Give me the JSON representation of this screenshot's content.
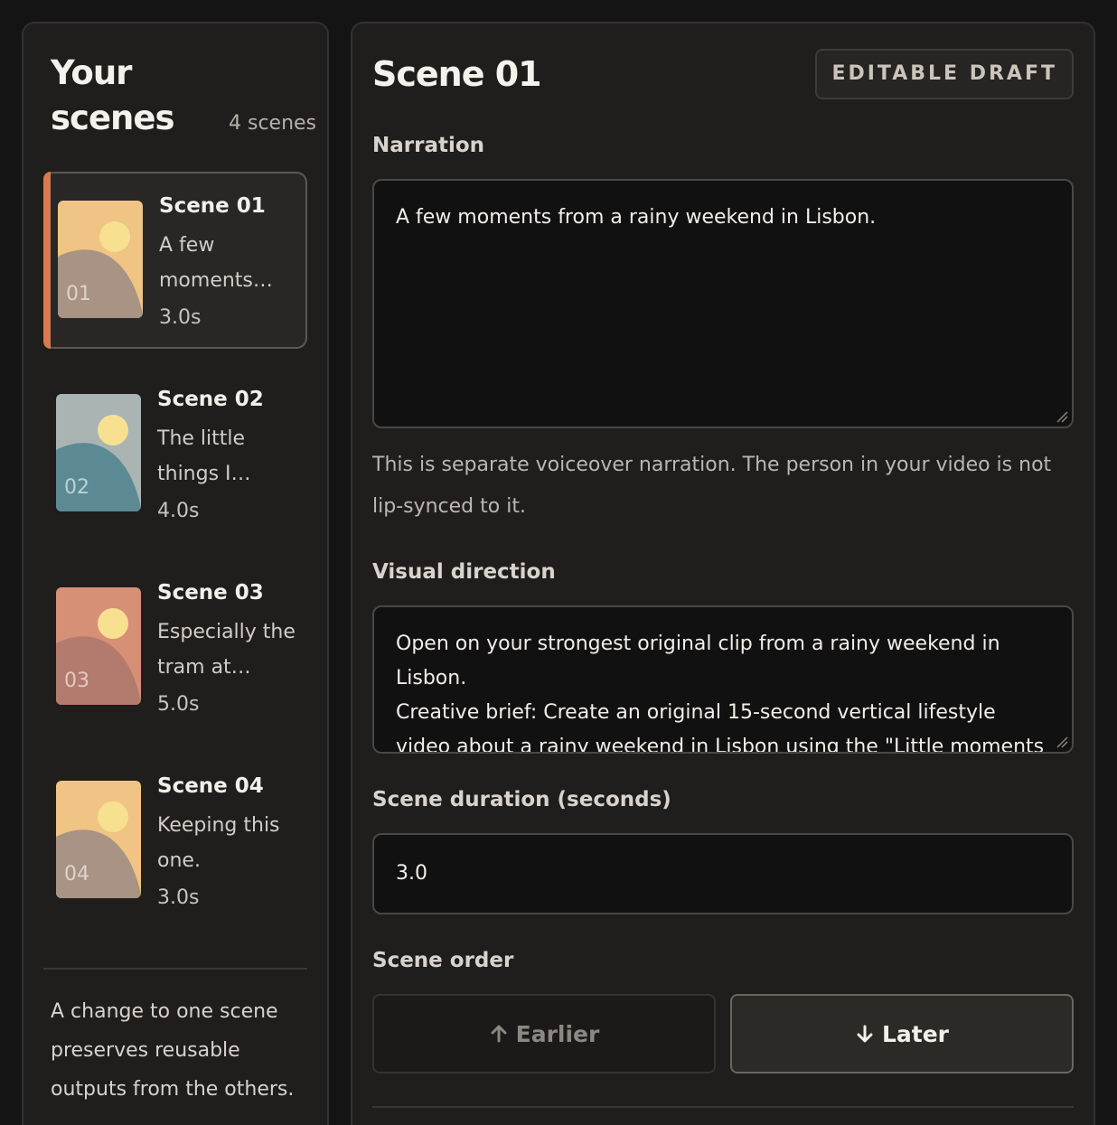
{
  "sidebar": {
    "title": "Your scenes",
    "count": "4 scenes",
    "note": "A change to one scene preserves reusable outputs from the others.",
    "scenes": [
      {
        "title": "Scene 01",
        "desc": "A few moments…",
        "duration": "3.0s",
        "num": "01",
        "bg": "#efc484",
        "hill": "#a89384",
        "sun": "#f7e08f",
        "active": true
      },
      {
        "title": "Scene 02",
        "desc": "The little things I…",
        "duration": "4.0s",
        "num": "02",
        "bg": "#a9b4b3",
        "hill": "#5b8a94",
        "sun": "#f7e08f",
        "active": false
      },
      {
        "title": "Scene 03",
        "desc": "Especially the tram at…",
        "duration": "5.0s",
        "num": "03",
        "bg": "#d59076",
        "hill": "#b37b6d",
        "sun": "#f7e08f",
        "active": false
      },
      {
        "title": "Scene 04",
        "desc": "Keeping this one.",
        "duration": "3.0s",
        "num": "04",
        "bg": "#efc484",
        "hill": "#a89384",
        "sun": "#f7e08f",
        "active": false
      }
    ]
  },
  "main": {
    "title": "Scene 01",
    "badge": "EDITABLE DRAFT",
    "narration": {
      "label": "Narration",
      "value": "A few moments from a rainy weekend in Lisbon.",
      "helper": "This is separate voiceover narration. The person in your video is not lip-synced to it."
    },
    "visual": {
      "label": "Visual direction",
      "value": "Open on your strongest original clip from a rainy weekend in Lisbon.\nCreative brief: Create an original 15-second vertical lifestyle video about a rainy weekend in Lisbon using the \"Little moments"
    },
    "duration": {
      "label": "Scene duration (seconds)",
      "value": "3.0"
    },
    "order": {
      "label": "Scene order",
      "earlier": "Earlier",
      "later": "Later"
    }
  }
}
